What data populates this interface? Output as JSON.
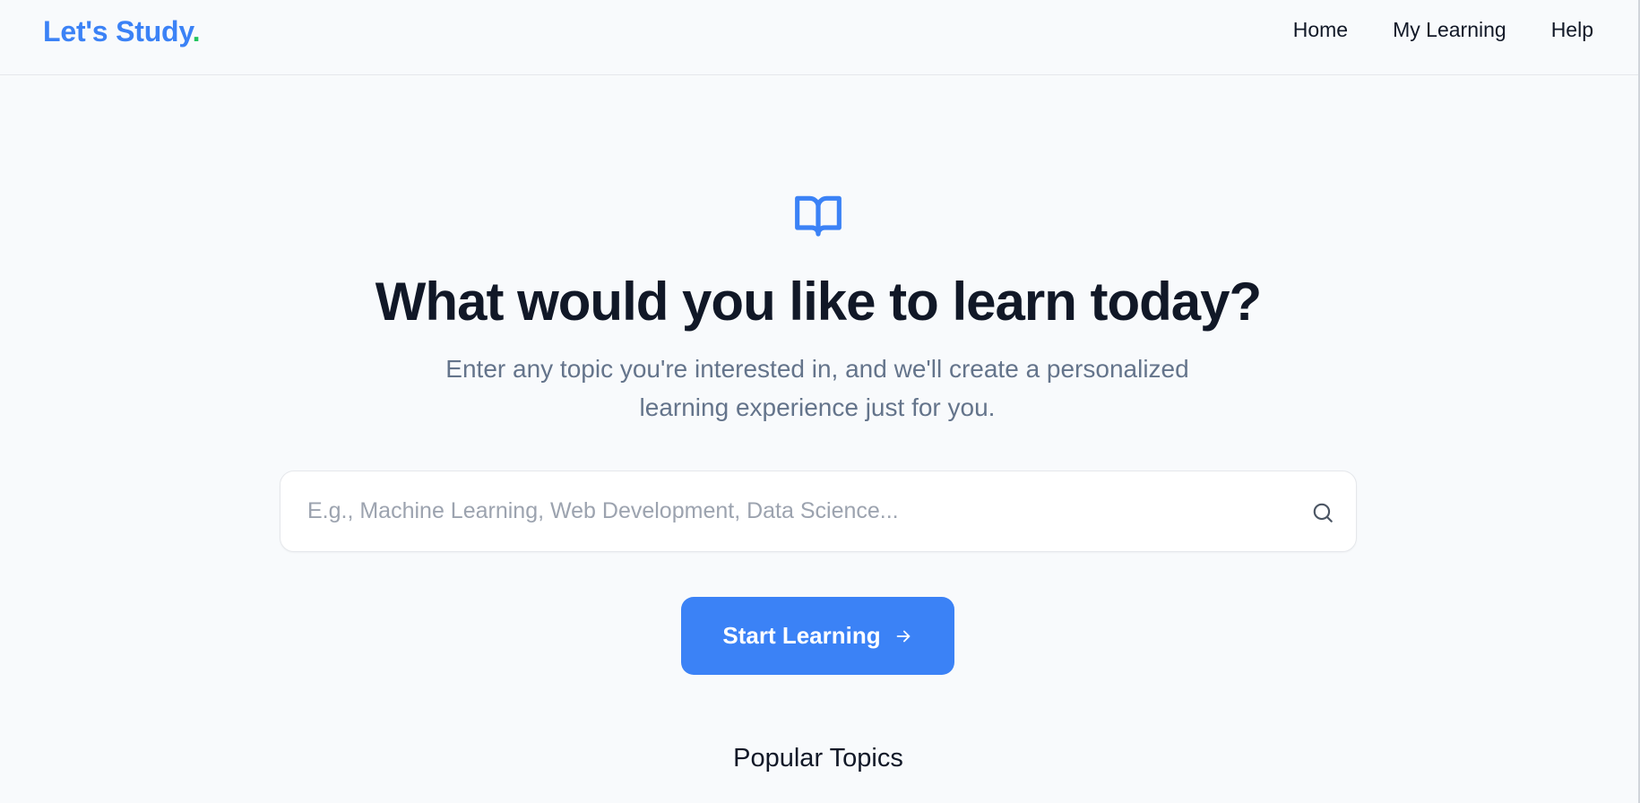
{
  "header": {
    "logo_text": "Let's Study",
    "logo_dot": ".",
    "nav": [
      {
        "label": "Home"
      },
      {
        "label": "My Learning"
      },
      {
        "label": "Help"
      }
    ]
  },
  "hero": {
    "icon": "book-open-icon",
    "title": "What would you like to learn today?",
    "subtitle": "Enter any topic you're interested in, and we'll create a personalized learning experience just for you.",
    "search": {
      "placeholder": "E.g., Machine Learning, Web Development, Data Science...",
      "value": "",
      "icon": "search-icon"
    },
    "start_button": {
      "label": "Start Learning",
      "icon": "arrow-right-icon"
    },
    "popular_heading": "Popular Topics"
  },
  "colors": {
    "accent": "#3b82f6",
    "logo_dot": "#22c55e",
    "background": "#f8fafc",
    "text": "#111827",
    "muted": "#64748b"
  }
}
